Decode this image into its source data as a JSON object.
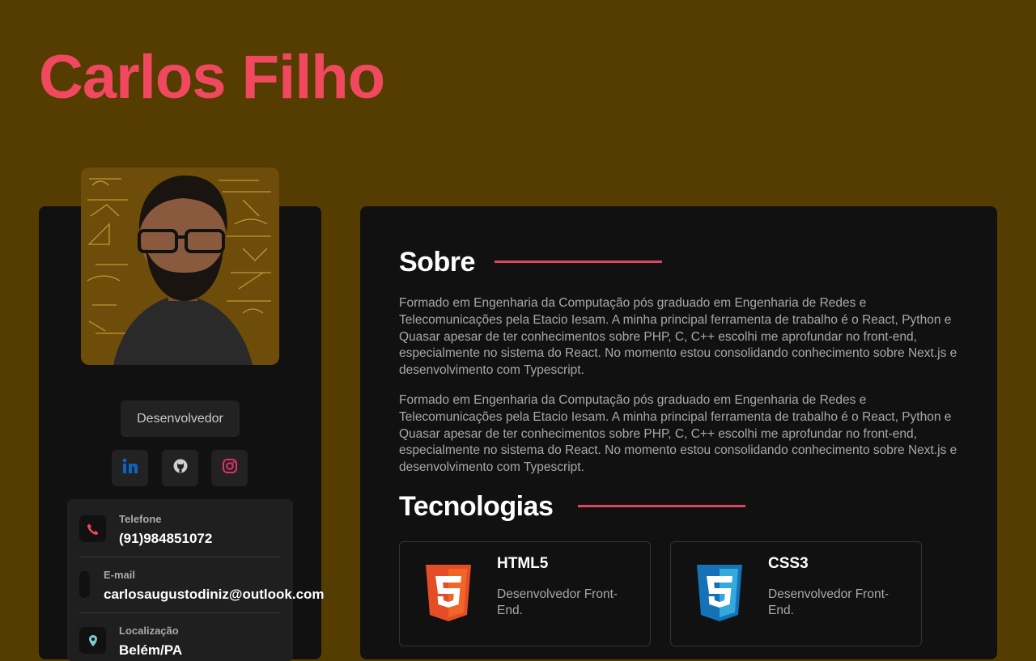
{
  "header": {
    "name": "Carlos Filho"
  },
  "profile": {
    "role": "Desenvolvedor",
    "social": [
      {
        "name": "linkedin",
        "icon": "linkedin-icon",
        "color": "#0a66c2"
      },
      {
        "name": "github",
        "icon": "github-icon",
        "color": "#cfcfcf"
      },
      {
        "name": "instagram",
        "icon": "instagram-icon",
        "color": "#e1306c"
      }
    ],
    "contacts": [
      {
        "label": "Telefone",
        "value": "(91)984851072",
        "icon": "phone-icon"
      },
      {
        "label": "E-mail",
        "value": "carlosaugustodiniz@outlook.com",
        "icon": "mail-icon"
      },
      {
        "label": "Localização",
        "value": "Belém/PA",
        "icon": "location-pin-icon"
      }
    ]
  },
  "about": {
    "title": "Sobre",
    "paragraphs": [
      "Formado em Engenharia da Computação pós graduado em Engenharia de Redes e Telecomunicações pela Etacio Iesam. A minha principal ferramenta de trabalho é o React, Python e Quasar apesar de ter conhecimentos sobre PHP, C, C++ escolhi me aprofundar no front-end, especialmente no sistema do React. No momento estou consolidando conhecimento sobre Next.js e desenvolvimento com Typescript.",
      "Formado em Engenharia da Computação pós graduado em Engenharia de Redes e Telecomunicações pela Etacio Iesam. A minha principal ferramenta de trabalho é o React, Python e Quasar apesar de ter conhecimentos sobre PHP, C, C++ escolhi me aprofundar no front-end, especialmente no sistema do React. No momento estou consolidando conhecimento sobre Next.js e desenvolvimento com Typescript."
    ]
  },
  "technologies": {
    "title": "Tecnologias",
    "items": [
      {
        "name": "HTML5",
        "description": "Desenvolvedor Front-End.",
        "icon": "html5-icon",
        "color": "#e44d26"
      },
      {
        "name": "CSS3",
        "description": "Desenvolvedor Front-End.",
        "icon": "css3-icon",
        "color": "#1572b6"
      }
    ]
  },
  "colors": {
    "background": "#553c00",
    "accent": "#f0485e",
    "panel": "#111111"
  }
}
